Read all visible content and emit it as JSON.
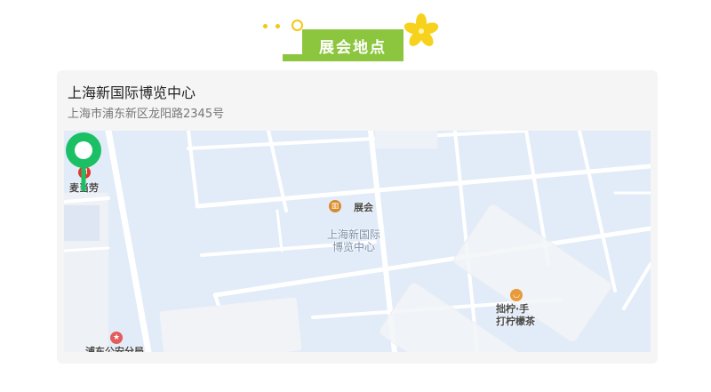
{
  "section": {
    "title": "展会地点"
  },
  "venue": {
    "name": "上海新国际博览中心",
    "address": "上海市浦东新区龙阳路2345号"
  },
  "map": {
    "pois": [
      {
        "id": "mcdonalds",
        "label": "麦当劳",
        "icon": "mcdonalds-icon",
        "color": "#e03a2e"
      },
      {
        "id": "venue-center",
        "label_line1": "上海新国际",
        "label_line2": "博览中心"
      },
      {
        "id": "partial-poi",
        "label": "展会",
        "icon": "exhibition-icon",
        "color": "#d98b2b"
      },
      {
        "id": "lemon-tea",
        "label_line1": "拙柠·手",
        "label_line2": "打柠檬茶",
        "icon": "tea-icon",
        "color": "#e89a3a"
      },
      {
        "id": "police",
        "label": "浦东公安分局",
        "icon": "police-icon",
        "color": "#e35b5b"
      }
    ],
    "pin_color": "#1bbf64"
  }
}
